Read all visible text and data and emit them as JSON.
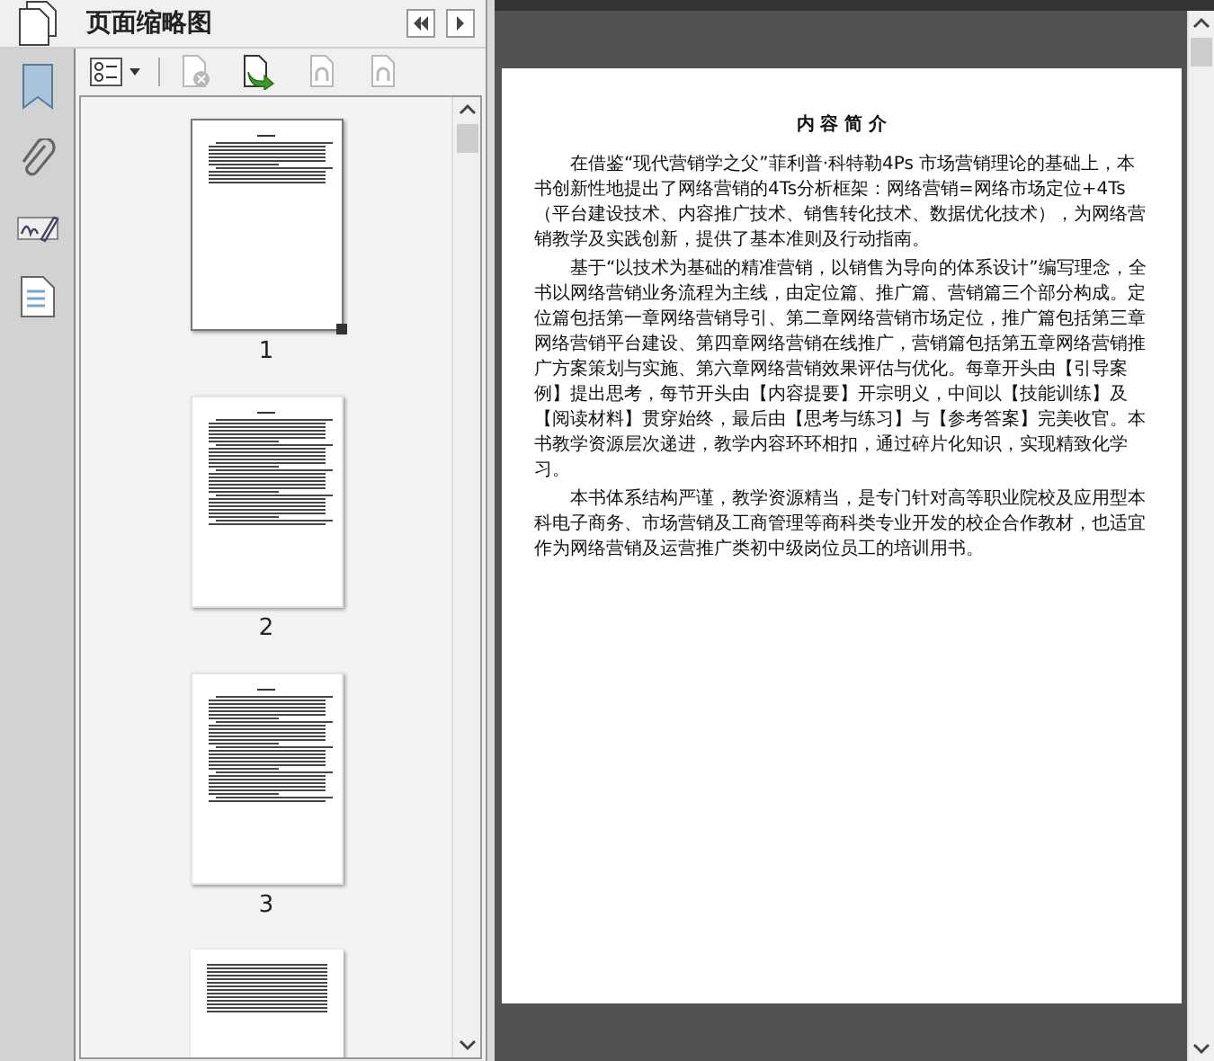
{
  "panel": {
    "title": "页面缩略图"
  },
  "toolbar": [
    {
      "kind": "options",
      "disabled": false
    },
    {
      "kind": "delete",
      "disabled": true
    },
    {
      "kind": "insert",
      "disabled": false
    },
    {
      "kind": "undo",
      "disabled": true
    },
    {
      "kind": "redo",
      "disabled": true
    }
  ],
  "thumbnails": [
    {
      "label": "1",
      "selected": true,
      "kind": "intro"
    },
    {
      "label": "2",
      "selected": false,
      "kind": "dense"
    },
    {
      "label": "3",
      "selected": false,
      "kind": "dense"
    }
  ],
  "document": {
    "heading": "内 容 简 介",
    "paragraphs": [
      "在借鉴“现代营销学之父”菲利普·科特勒4Ps 市场营销理论的基础上，本书创新性地提出了网络营销的4Ts分析框架：网络营销=网络市场定位+4Ts（平台建设技术、内容推广技术、销售转化技术、数据优化技术），为网络营销教学及实践创新，提供了基本准则及行动指南。",
      "基于“以技术为基础的精准营销，以销售为导向的体系设计”编写理念，全书以网络营销业务流程为主线，由定位篇、推广篇、营销篇三个部分构成。定位篇包括第一章网络营销导引、第二章网络营销市场定位，推广篇包括第三章网络营销平台建设、第四章网络营销在线推广，营销篇包括第五章网络营销推广方案策划与实施、第六章网络营销效果评估与优化。每章开头由【引导案例】提出思考，每节开头由【内容提要】开宗明义，中间以【技能训练】及【阅读材料】贯穿始终，最后由【思考与练习】与【参考答案】完美收官。本书教学资源层次递进，教学内容环环相扣，通过碎片化知识，实现精致化学习。",
      "本书体系结构严谨，教学资源精当，是专门针对高等职业院校及应用型本科电子商务、市场营销及工商管理等商科类专业开发的校企合作教材，也适宜作为网络营销及运营推广类初中级岗位员工的培训用书。"
    ]
  }
}
